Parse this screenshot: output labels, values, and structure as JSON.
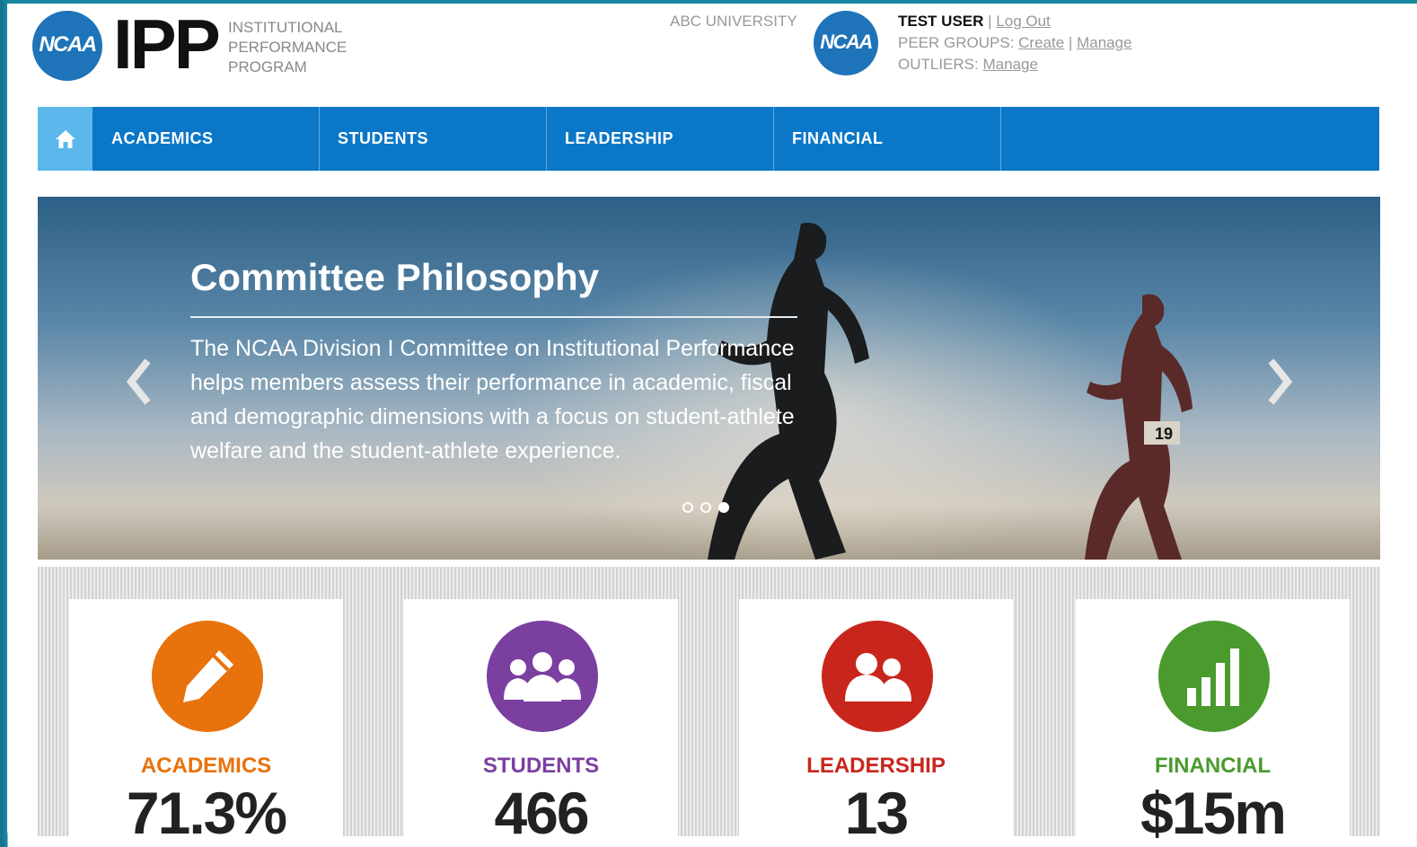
{
  "header": {
    "brand": "IPP",
    "brand_subtitle": [
      "INSTITUTIONAL",
      "PERFORMANCE",
      "PROGRAM"
    ],
    "logo_text": "NCAA",
    "university": "ABC UNIVERSITY",
    "user_name": "TEST USER",
    "logout_label": "Log Out",
    "peer_groups_label": "PEER GROUPS:",
    "create_label": "Create",
    "manage_label": "Manage",
    "outliers_label": "OUTLIERS:",
    "outliers_manage_label": "Manage",
    "separator": "|"
  },
  "nav": {
    "items": [
      {
        "label": "ACADEMICS"
      },
      {
        "label": "STUDENTS"
      },
      {
        "label": "LEADERSHIP"
      },
      {
        "label": "FINANCIAL"
      }
    ]
  },
  "hero": {
    "title": "Committee Philosophy",
    "description": "The NCAA Division I Committee on Institutional Performance helps members assess their performance in academic, fiscal and demographic dimensions with a focus on student-athlete welfare and the student-athlete experience.",
    "slide_count": 3,
    "active_slide": 3,
    "bib_number": "19"
  },
  "cards": [
    {
      "label": "ACADEMICS",
      "value": "71.3%",
      "color": "#e8720c",
      "icon": "pencil-icon"
    },
    {
      "label": "STUDENTS",
      "value": "466",
      "color": "#7b3fa0",
      "icon": "group-icon"
    },
    {
      "label": "LEADERSHIP",
      "value": "13",
      "color": "#c8261d",
      "icon": "people-icon"
    },
    {
      "label": "FINANCIAL",
      "value": "$15m",
      "color": "#4a9a2e",
      "icon": "bar-chart-icon"
    }
  ]
}
